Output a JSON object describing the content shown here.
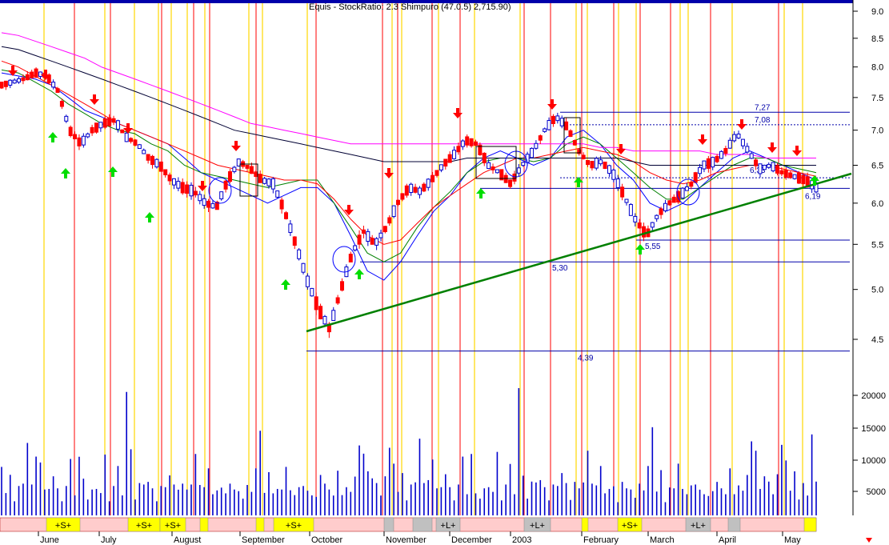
{
  "window": {
    "title": "Equis - StockRatio: 2.3 Shimpuro (47.0.5) 2,715.90)"
  },
  "colors": {
    "up_candle": "#0000cc",
    "down_candle": "#ff0000",
    "buy_arrow": "#00dd00",
    "sell_arrow": "#ff0000",
    "red_line": "#ff0000",
    "yellow_line": "#ffd700",
    "trendline": "#008000",
    "level_line": "#0000aa",
    "ma_fast": "#0000ff",
    "ma_mid": "#008000",
    "ma_slow": "#ff0000",
    "ma_200": "#000033",
    "ma_magenta": "#ff00ff",
    "volume": "#0000cc",
    "band_yellow": "#ffff00",
    "band_pink": "#ffcccc",
    "band_gray": "#c0c0c0"
  },
  "chart_data": {
    "type": "line",
    "title": "Equis - StockRatio: 2.3 Shimpuro (47.0.5) 2,715.90)",
    "price_axis": {
      "ticks": [
        "9.0",
        "8.5",
        "8.0",
        "7.5",
        "7.0",
        "6.5",
        "6.0",
        "5.5",
        "5.0",
        "4.5"
      ],
      "ylim": [
        4.3,
        9.1
      ]
    },
    "volume_axis": {
      "ticks": [
        "20000",
        "15000",
        "10000",
        "5000"
      ],
      "ylim": [
        0,
        22000
      ]
    },
    "x_labels": [
      "June",
      "July",
      "August",
      "September",
      "October",
      "November",
      "December",
      "2003",
      "February",
      "March",
      "April",
      "May"
    ],
    "price_series": {
      "name": "price",
      "values": [
        7.7,
        7.75,
        7.8,
        7.9,
        7.85,
        7.6,
        7.0,
        6.8,
        7.0,
        7.1,
        7.15,
        6.9,
        6.8,
        6.6,
        6.5,
        6.3,
        6.2,
        6.15,
        6.0,
        5.95,
        6.3,
        6.55,
        6.45,
        6.3,
        6.25,
        5.9,
        5.5,
        5.1,
        4.8,
        4.6,
        5.0,
        5.4,
        5.65,
        5.5,
        5.7,
        6.0,
        6.2,
        6.15,
        6.3,
        6.5,
        6.65,
        6.85,
        6.8,
        6.5,
        6.4,
        6.25,
        6.5,
        6.7,
        7.0,
        7.2,
        7.05,
        6.7,
        6.5,
        6.55,
        6.4,
        6.1,
        5.8,
        5.6,
        5.85,
        6.0,
        6.1,
        6.25,
        6.5,
        6.55,
        6.7,
        6.95,
        6.7,
        6.45,
        6.5,
        6.4,
        6.35,
        6.3,
        6.2
      ]
    },
    "moving_averages": [
      {
        "values": [
          7.9,
          7.85,
          7.8,
          7.7,
          7.5,
          7.3,
          7.2,
          7.1,
          7.0,
          6.9,
          6.8,
          6.6,
          6.4,
          6.3,
          6.2,
          6.1,
          6.0,
          6.1,
          6.2,
          6.2,
          6.0,
          5.6,
          5.2,
          5.1,
          5.3,
          5.6,
          5.9,
          6.1,
          6.4,
          6.6,
          6.7,
          6.6,
          6.5,
          6.6,
          6.9,
          7.0,
          6.8,
          6.5,
          6.3,
          6.0,
          5.9,
          6.0,
          6.2,
          6.4,
          6.6,
          6.7,
          6.6,
          6.5,
          6.4,
          6.3
        ]
      },
      {
        "values": [
          7.95,
          7.9,
          7.75,
          7.6,
          7.4,
          7.25,
          7.1,
          7.0,
          6.95,
          6.8,
          6.7,
          6.5,
          6.4,
          6.35,
          6.3,
          6.25,
          6.2,
          6.25,
          6.3,
          6.3,
          6.0,
          5.7,
          5.4,
          5.3,
          5.4,
          5.7,
          5.95,
          6.15,
          6.4,
          6.55,
          6.6,
          6.6,
          6.55,
          6.6,
          6.8,
          6.9,
          6.8,
          6.6,
          6.4,
          6.2,
          6.05,
          6.05,
          6.2,
          6.35,
          6.5,
          6.6,
          6.6,
          6.5,
          6.45,
          6.4
        ]
      },
      {
        "values": [
          8.1,
          8.0,
          7.85,
          7.7,
          7.55,
          7.4,
          7.25,
          7.1,
          7.0,
          6.9,
          6.8,
          6.7,
          6.6,
          6.5,
          6.45,
          6.4,
          6.35,
          6.3,
          6.3,
          6.25,
          6.05,
          5.8,
          5.6,
          5.5,
          5.55,
          5.75,
          5.95,
          6.1,
          6.25,
          6.4,
          6.5,
          6.6,
          6.6,
          6.65,
          6.7,
          6.75,
          6.7,
          6.65,
          6.55,
          6.4,
          6.3,
          6.25,
          6.3,
          6.4,
          6.45,
          6.5,
          6.5,
          6.45,
          6.4,
          6.35
        ]
      },
      {
        "values": [
          8.35,
          8.3,
          8.2,
          8.1,
          8.0,
          7.9,
          7.8,
          7.7,
          7.6,
          7.5,
          7.4,
          7.3,
          7.2,
          7.1,
          7.0,
          6.95,
          6.9,
          6.85,
          6.8,
          6.75,
          6.7,
          6.65,
          6.6,
          6.55,
          6.55,
          6.55,
          6.55,
          6.55,
          6.6,
          6.6,
          6.6,
          6.6,
          6.6,
          6.6,
          6.6,
          6.6,
          6.6,
          6.6,
          6.55,
          6.5,
          6.5,
          6.5,
          6.5,
          6.5,
          6.5,
          6.5,
          6.5,
          6.5,
          6.5,
          6.5
        ]
      },
      {
        "values": [
          8.6,
          8.55,
          8.45,
          8.35,
          8.25,
          8.15,
          8.0,
          7.9,
          7.8,
          7.7,
          7.6,
          7.5,
          7.4,
          7.3,
          7.2,
          7.1,
          7.05,
          7.0,
          6.95,
          6.9,
          6.85,
          6.8,
          6.8,
          6.8,
          6.8,
          6.8,
          6.8,
          6.8,
          6.8,
          6.8,
          6.8,
          6.8,
          6.8,
          6.8,
          6.8,
          6.8,
          6.75,
          6.75,
          6.7,
          6.7,
          6.7,
          6.7,
          6.7,
          6.65,
          6.65,
          6.65,
          6.6,
          6.6,
          6.6,
          6.6
        ]
      }
    ],
    "volume_series": {
      "name": "volume",
      "values": [
        11000,
        4000,
        6000,
        3000,
        5000,
        4500,
        14500,
        5000,
        8000,
        10000,
        4000,
        6000,
        7000,
        4000,
        3000,
        5000,
        8000,
        4000,
        9500,
        5000,
        3000,
        4000,
        6000,
        4000,
        9000,
        3000,
        5000,
        7000,
        4000,
        20000,
        9000,
        3000,
        5000,
        7000,
        6000,
        4000,
        3000,
        5000,
        4000,
        8000,
        5000,
        3500,
        6000,
        4000,
        7000,
        11000,
        4500,
        6000,
        8000,
        3000,
        5000,
        4500,
        3000,
        6000,
        4000,
        5500,
        3000,
        4500,
        5000,
        8000,
        12000,
        4500,
        7000,
        3000,
        5000,
        4000,
        11000,
        4500,
        3000,
        6000,
        5000,
        3500,
        4000,
        3000,
        5500,
        6000,
        4000,
        4500,
        8000,
        3000,
        6000,
        4000,
        5500,
        14000,
        10000,
        6000,
        7000,
        5000,
        4500,
        7000,
        10000
      ]
    },
    "levels": [
      {
        "label": "7,27",
        "value": 7.27
      },
      {
        "label": "7,08",
        "value": 7.08
      },
      {
        "label": "6,33",
        "value": 6.33
      },
      {
        "label": "6,19",
        "value": 6.19
      },
      {
        "label": "5,55",
        "value": 5.55
      },
      {
        "label": "5,30",
        "value": 5.3
      },
      {
        "label": "4,39",
        "value": 4.39
      }
    ],
    "band_labels": [
      "+S+",
      "+S+",
      "+S+",
      "+S+",
      "+L+",
      "+L+",
      "+L+",
      "+S+"
    ],
    "grid": false
  }
}
